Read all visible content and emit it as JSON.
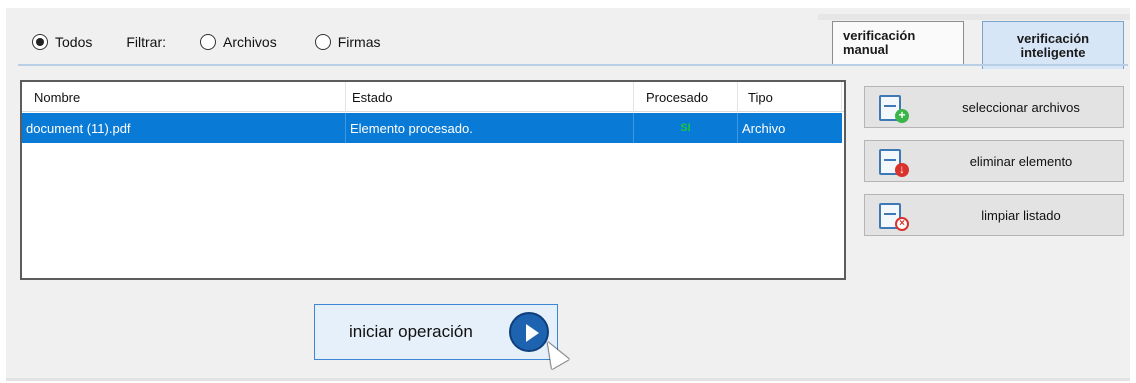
{
  "filters": {
    "todos_label": "Todos",
    "filtrar_label": "Filtrar:",
    "archivos_label": "Archivos",
    "firmas_label": "Firmas",
    "selected": "Todos"
  },
  "tabs": [
    {
      "label_line1": "verificación",
      "label_line2": "manual"
    },
    {
      "label_line1": "verificación",
      "label_line2": "inteligente"
    }
  ],
  "list": {
    "columns": [
      "Nombre",
      "Estado",
      "Procesado",
      "Tipo"
    ],
    "rows": [
      {
        "nombre": "document (11).pdf",
        "estado": "Elemento procesado.",
        "procesado": "SI",
        "tipo": "Archivo"
      }
    ]
  },
  "side_buttons": {
    "select_label": "seleccionar archivos",
    "delete_label": "eliminar elemento",
    "clear_label": "limpiar listado"
  },
  "start_button": {
    "label": "iniciar operación"
  },
  "icons": {
    "add": "file-add-icon",
    "delete": "file-delete-icon",
    "clear": "file-clear-icon",
    "play": "play-icon",
    "cursor": "mouse-cursor-icon"
  },
  "colors": {
    "selected_row": "#0a7ad7",
    "processed_yes": "#18c83a",
    "active_tab": "#d7e6f6",
    "start_border": "#3f86d2"
  }
}
